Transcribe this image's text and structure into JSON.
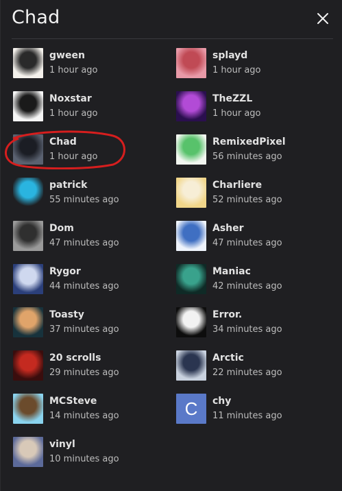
{
  "header": {
    "title": "Chad",
    "close_icon": "close-icon"
  },
  "users": [
    {
      "name": "gween",
      "time": "1 hour ago",
      "avatar": "photo",
      "colors": [
        "#f4f1ec",
        "#2a2a2a"
      ]
    },
    {
      "name": "splayd",
      "time": "1 hour ago",
      "avatar": "photo",
      "colors": [
        "#e89aa8",
        "#c04a55"
      ]
    },
    {
      "name": "Noxstar",
      "time": "1 hour ago",
      "avatar": "photo",
      "colors": [
        "#f5f5f5",
        "#1a1a1a"
      ]
    },
    {
      "name": "TheZZL",
      "time": "1 hour ago",
      "avatar": "photo",
      "colors": [
        "#2a0f4e",
        "#b24bd6"
      ]
    },
    {
      "name": "Chad",
      "time": "1 hour ago",
      "avatar": "photo",
      "colors": [
        "#5a6170",
        "#1b1d24"
      ]
    },
    {
      "name": "RemixedPixel",
      "time": "56 minutes ago",
      "avatar": "photo",
      "colors": [
        "#f2f6f0",
        "#58c26b"
      ]
    },
    {
      "name": "patrick",
      "time": "55 minutes ago",
      "avatar": "photo",
      "colors": [
        "#1f1f22",
        "#2ab4e0"
      ]
    },
    {
      "name": "Charliere",
      "time": "52 minutes ago",
      "avatar": "photo",
      "colors": [
        "#f1d68a",
        "#f7eed6"
      ]
    },
    {
      "name": "Dom",
      "time": "47 minutes ago",
      "avatar": "photo",
      "colors": [
        "#9a9a9a",
        "#2f2f2f"
      ]
    },
    {
      "name": "Asher",
      "time": "47 minutes ago",
      "avatar": "photo",
      "colors": [
        "#eef3fb",
        "#3f6fc2"
      ]
    },
    {
      "name": "Rygor",
      "time": "44 minutes ago",
      "avatar": "photo",
      "colors": [
        "#2b3f7a",
        "#cfd8ef"
      ]
    },
    {
      "name": "Maniac",
      "time": "42 minutes ago",
      "avatar": "photo",
      "colors": [
        "#0f2a26",
        "#39a28c"
      ]
    },
    {
      "name": "Toasty",
      "time": "37 minutes ago",
      "avatar": "photo",
      "colors": [
        "#17323c",
        "#e0a46a"
      ]
    },
    {
      "name": "Error.",
      "time": "34 minutes ago",
      "avatar": "photo",
      "colors": [
        "#0d0d0d",
        "#f2f2f2"
      ]
    },
    {
      "name": "20 scrolls",
      "time": "29 minutes ago",
      "avatar": "photo",
      "colors": [
        "#3a0d0d",
        "#c42a20"
      ]
    },
    {
      "name": "Arctic",
      "time": "22 minutes ago",
      "avatar": "photo",
      "colors": [
        "#c9d2df",
        "#2a3550"
      ]
    },
    {
      "name": "MCSteve",
      "time": "14 minutes ago",
      "avatar": "photo",
      "colors": [
        "#8ad3ee",
        "#6b4b2c"
      ]
    },
    {
      "name": "chy",
      "time": "11 minutes ago",
      "avatar": "letter",
      "letter": "C",
      "colors": [
        "#5a79c8",
        "#5a79c8"
      ]
    },
    {
      "name": "vinyl",
      "time": "10 minutes ago",
      "avatar": "photo",
      "colors": [
        "#5c6a9a",
        "#d8c9b8"
      ]
    }
  ],
  "highlight": {
    "color": "#d61e1e",
    "target": "Chad"
  }
}
